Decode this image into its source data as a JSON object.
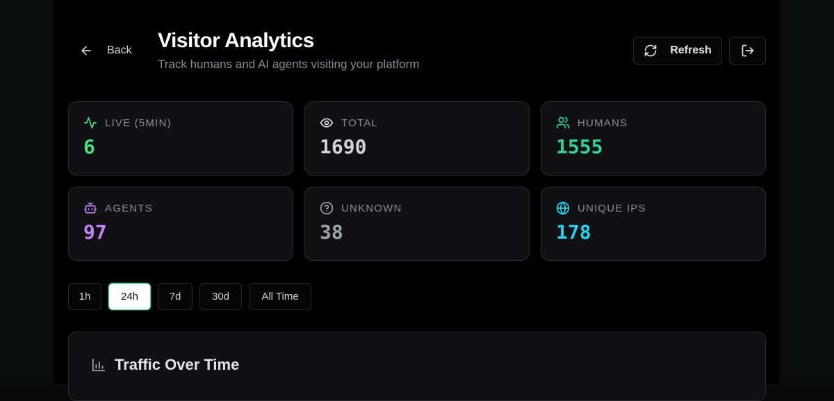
{
  "header": {
    "back_label": "Back",
    "title": "Visitor Analytics",
    "subtitle": "Track humans and AI agents visiting your platform",
    "refresh_label": "Refresh"
  },
  "stats": [
    {
      "label": "LIVE (5MIN)",
      "value": "6",
      "icon": "activity-icon",
      "color": "#4ade80"
    },
    {
      "label": "TOTAL",
      "value": "1690",
      "icon": "eye-icon",
      "color": "#d4d4d8"
    },
    {
      "label": "HUMANS",
      "value": "1555",
      "icon": "users-icon",
      "color": "#34d399"
    },
    {
      "label": "AGENTS",
      "value": "97",
      "icon": "bot-icon",
      "color": "#c084fc"
    },
    {
      "label": "UNKNOWN",
      "value": "38",
      "icon": "help-circle-icon",
      "color": "#a1a1aa"
    },
    {
      "label": "UNIQUE IPS",
      "value": "178",
      "icon": "globe-icon",
      "color": "#22d3ee"
    }
  ],
  "time_ranges": [
    {
      "label": "1h"
    },
    {
      "label": "24h",
      "active": true
    },
    {
      "label": "7d"
    },
    {
      "label": "30d"
    },
    {
      "label": "All Time"
    }
  ],
  "traffic_panel": {
    "title": "Traffic Over Time",
    "icon": "bar-chart-icon"
  }
}
